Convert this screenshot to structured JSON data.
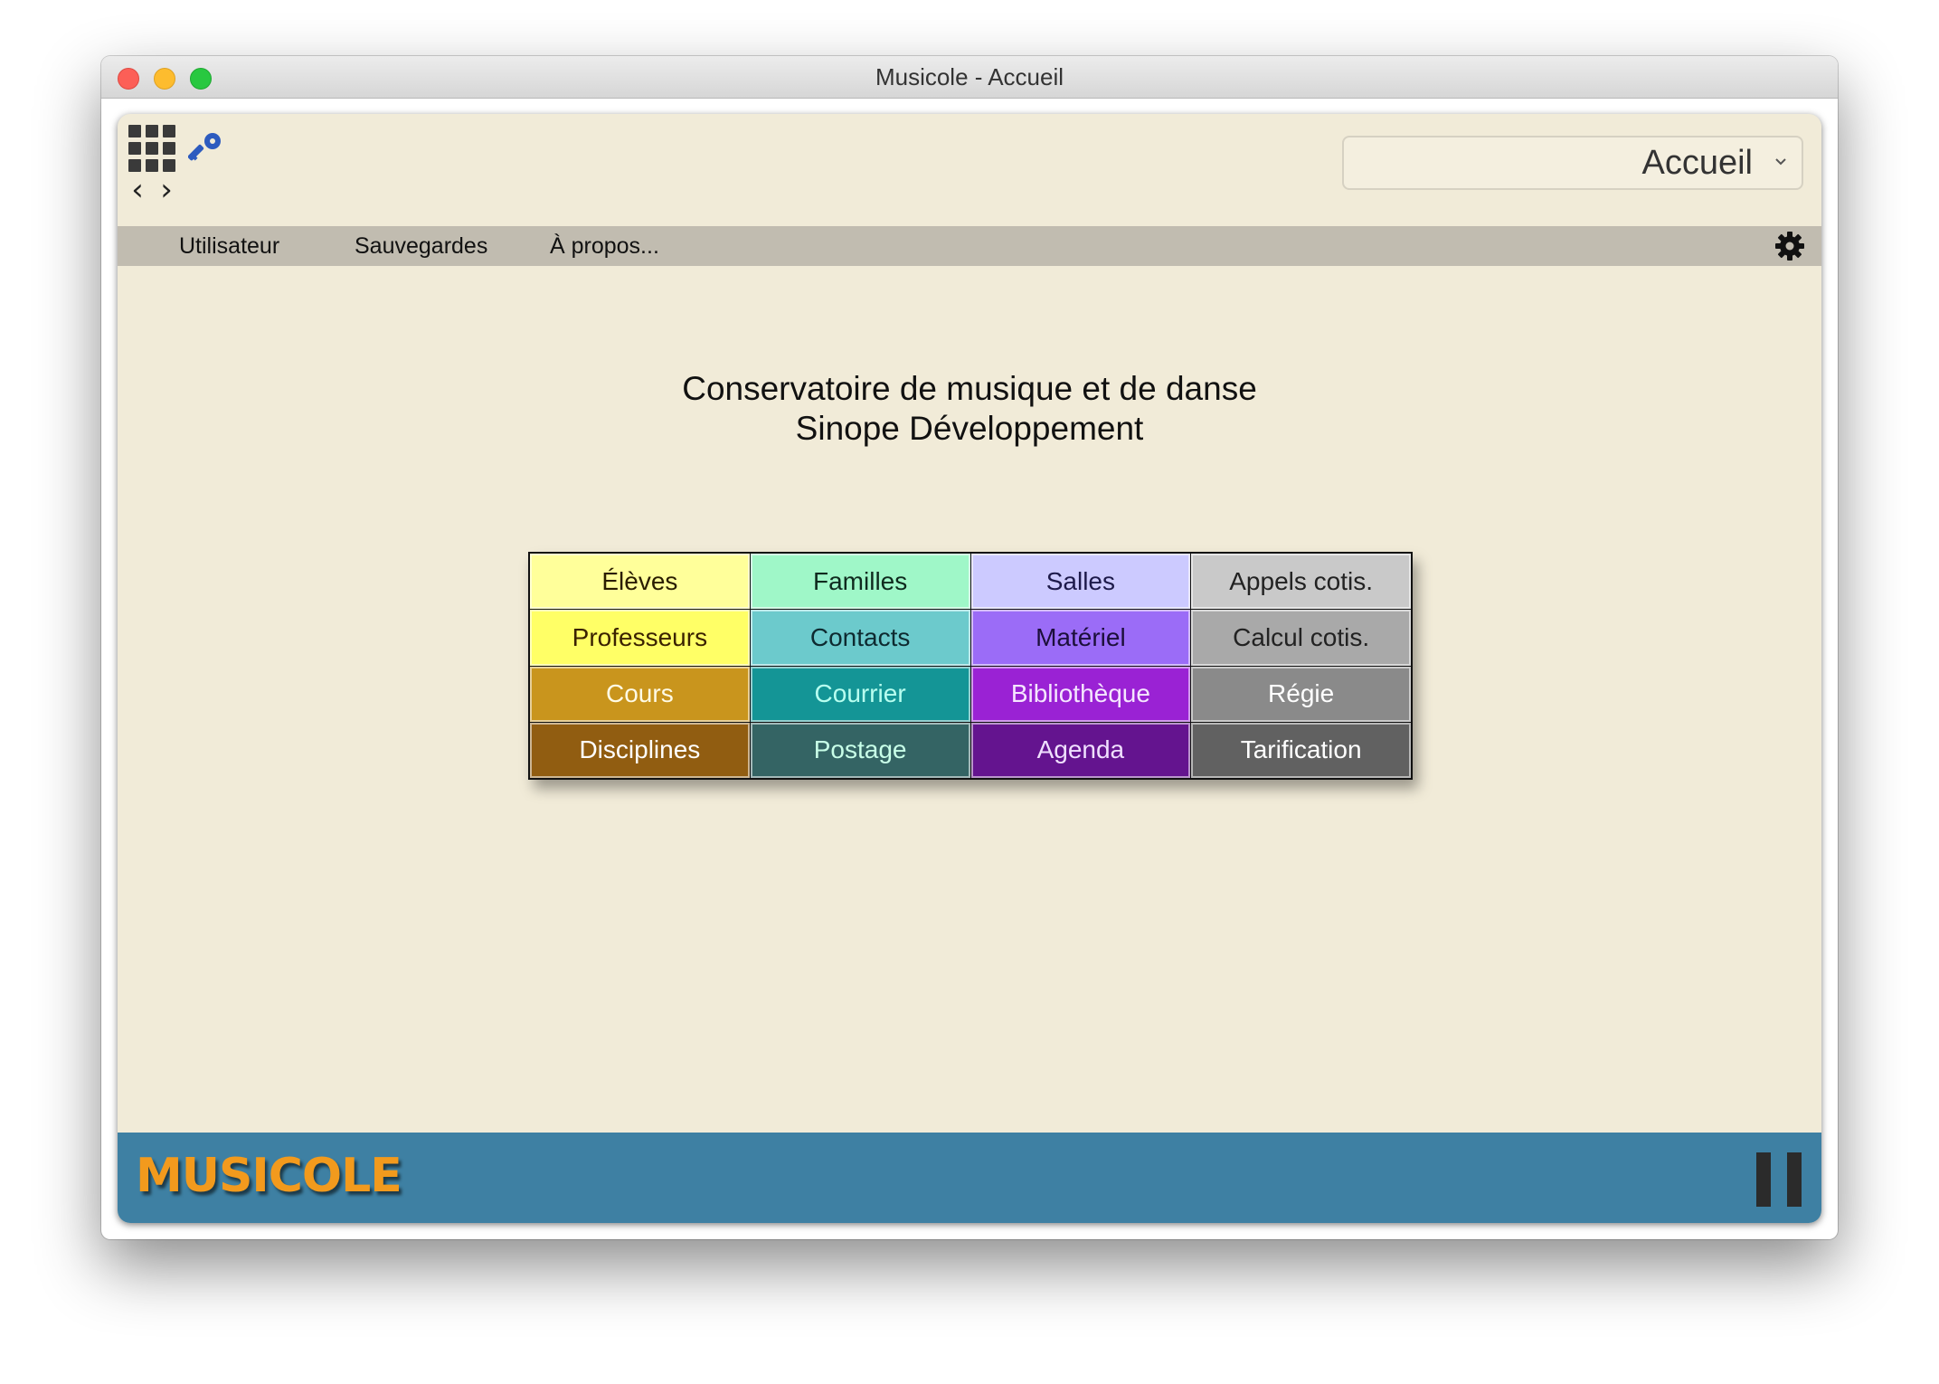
{
  "window": {
    "title": "Musicole - Accueil"
  },
  "toolbar": {
    "page_select_value": "Accueil",
    "nav_back_glyph": "‹",
    "nav_forward_glyph": "›",
    "icons": [
      "apps-grid-icon",
      "key-icon",
      "chevron-left-icon",
      "chevron-right-icon",
      "chevron-down-icon"
    ]
  },
  "menubar": {
    "items": [
      {
        "label": "Utilisateur"
      },
      {
        "label": "Sauvegardes"
      },
      {
        "label": "À propos..."
      }
    ],
    "settings_icon": "gear-icon"
  },
  "main": {
    "title_line1": "Conservatoire de musique et de danse",
    "title_line2": "Sinope Développement"
  },
  "tiles": [
    {
      "label": "Élèves",
      "bg": "#ffff9a",
      "fg": "#2a1d00"
    },
    {
      "label": "Familles",
      "bg": "#9ff7c8",
      "fg": "#0f2a1e"
    },
    {
      "label": "Salles",
      "bg": "#cccaff",
      "fg": "#1d1a4a"
    },
    {
      "label": "Appels cotis.",
      "bg": "#c9c9c9",
      "fg": "#222222"
    },
    {
      "label": "Professeurs",
      "bg": "#ffff66",
      "fg": "#3a2200"
    },
    {
      "label": "Contacts",
      "bg": "#6ccacc",
      "fg": "#0e2a30"
    },
    {
      "label": "Matériel",
      "bg": "#9b6cf7",
      "fg": "#1c0f3a"
    },
    {
      "label": "Calcul cotis.",
      "bg": "#a9a9a9",
      "fg": "#222222"
    },
    {
      "label": "Cours",
      "bg": "#c9951d",
      "fg": "#fffbe6"
    },
    {
      "label": "Courrier",
      "bg": "#149596",
      "fg": "#b8fff0"
    },
    {
      "label": "Bibliothèque",
      "bg": "#9a22d4",
      "fg": "#f5e6ff"
    },
    {
      "label": "Régie",
      "bg": "#8a8a8a",
      "fg": "#ffffff"
    },
    {
      "label": "Disciplines",
      "bg": "#915d11",
      "fg": "#ffffff"
    },
    {
      "label": "Postage",
      "bg": "#346464",
      "fg": "#c8ffe8"
    },
    {
      "label": "Agenda",
      "bg": "#64148f",
      "fg": "#f0e0ff"
    },
    {
      "label": "Tarification",
      "bg": "#616161",
      "fg": "#ffffff"
    }
  ],
  "footer": {
    "logo_text": "MUSICOLE",
    "pause_icon": "pause-icon",
    "colors": {
      "bar": "#3e80a3",
      "logo": "#f29a1d"
    }
  },
  "colors": {
    "app_background": "#f1ebd8",
    "menubar_background": "#c1bcb0"
  }
}
